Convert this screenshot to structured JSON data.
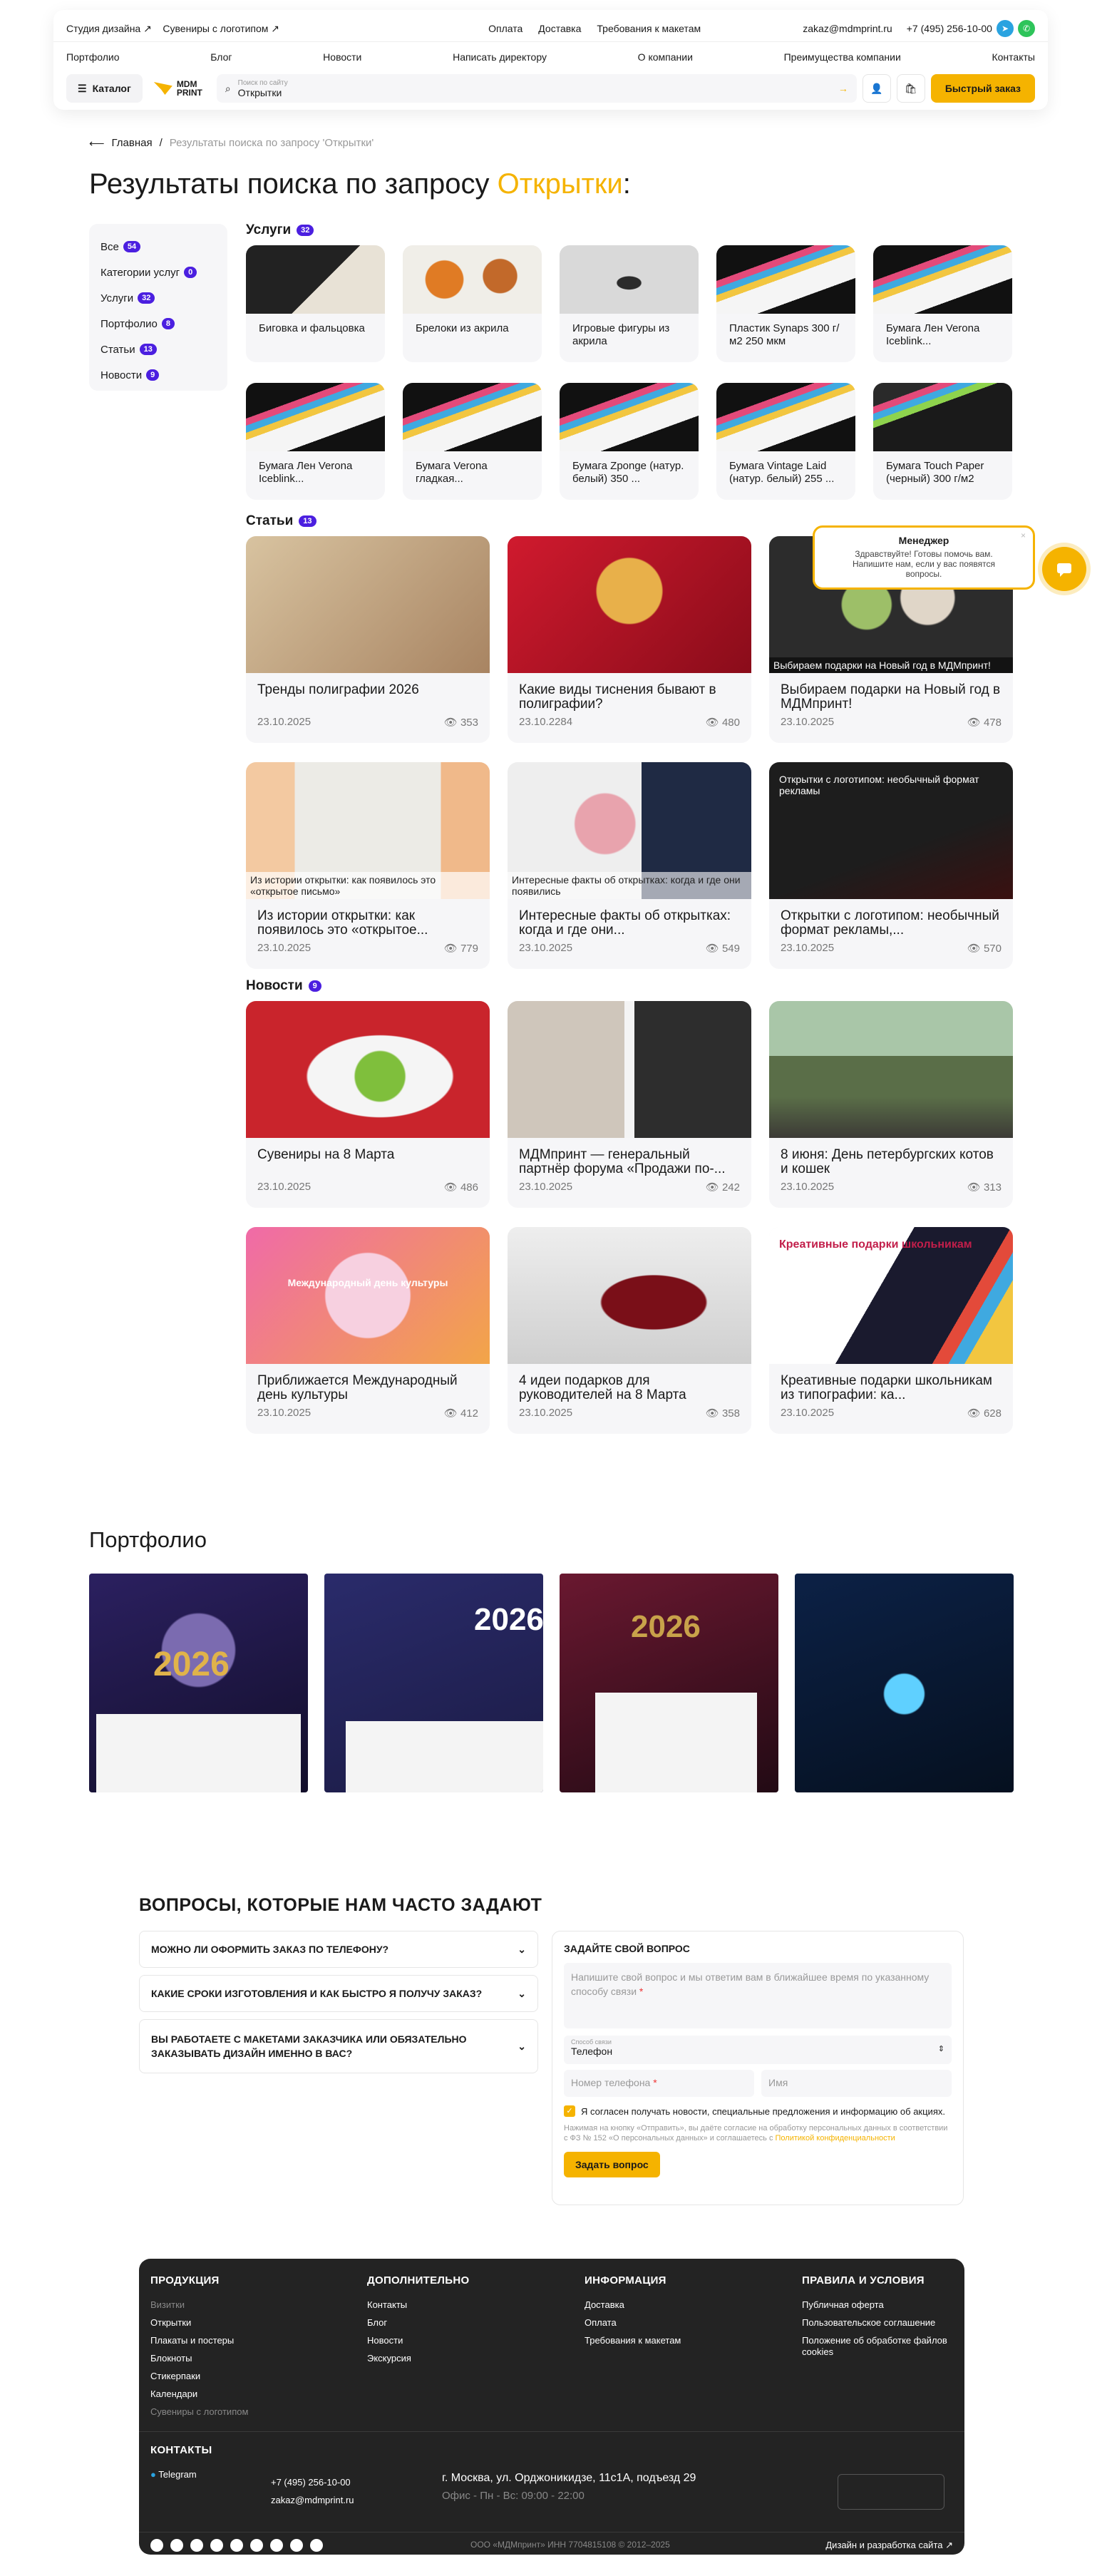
{
  "header": {
    "top_links": [
      "Студия дизайна",
      "Сувениры с логотипом"
    ],
    "mid_links": [
      "Оплата",
      "Доставка",
      "Требования к макетам"
    ],
    "email": "zakaz@mdmprint.ru",
    "phone": "+7 (495) 256-10-00",
    "nav": [
      "Портфолио",
      "Блог",
      "Новости",
      "Написать директору",
      "О компании",
      "Преимущества компании",
      "Контакты"
    ],
    "catalog": "Каталог",
    "logo": "MDM PRINT",
    "search_placeholder": "Поиск по сайту",
    "search_value": "Открытки",
    "quick_order": "Быстрый заказ"
  },
  "breadcrumbs": {
    "home": "Главная",
    "current": "Результаты поиска по запросу 'Открытки'"
  },
  "title": {
    "prefix": "Результаты поиска по запросу ",
    "query": "Открытки",
    "suffix": ":"
  },
  "filters": [
    {
      "label": "Все",
      "count": "54"
    },
    {
      "label": "Категории услуг",
      "count": "0"
    },
    {
      "label": "Услуги",
      "count": "32"
    },
    {
      "label": "Портфолио",
      "count": "8"
    },
    {
      "label": "Статьи",
      "count": "13"
    },
    {
      "label": "Новости",
      "count": "9"
    }
  ],
  "services": {
    "title": "Услуги",
    "count": "32",
    "items": [
      "Биговка и фальцовка",
      "Брелоки из акрила",
      "Игровые фигуры из акрила",
      "Пластик Synaps 300 г/м2 250 мкм",
      "Бумага Лен Verona Iceblink...",
      "Бумага Лен Verona Iceblink...",
      "Бумага Verona гладкая...",
      "Бумага Zponge (натур. белый) 350 ...",
      "Бумага Vintage Laid (натур. белый) 255 ...",
      "Бумага Touch Paper (черный) 300 г/м2"
    ]
  },
  "articles": {
    "title": "Статьи",
    "count": "13",
    "items": [
      {
        "title": "Тренды полиграфии 2026",
        "date": "23.10.2025",
        "views": "353"
      },
      {
        "title": "Какие виды тиснения бывают в полиграфии?",
        "date": "23.10.2284",
        "views": "480"
      },
      {
        "title": "Выбираем подарки на Новый год в МДМпринт!",
        "date": "23.10.2025",
        "views": "478",
        "caption": "Выбираем подарки на Новый год в МДМпринт!"
      },
      {
        "title": "Из истории открытки: как появилось это «открытое...",
        "date": "23.10.2025",
        "views": "779",
        "caption": "Из истории открытки: как появилось это «открытое письмо»"
      },
      {
        "title": "Интересные факты об открытках: когда и где они...",
        "date": "23.10.2025",
        "views": "549",
        "caption": "Интересные факты об открытках: когда и где они появились"
      },
      {
        "title": "Открытки с логотипом: необычный формат рекламы,...",
        "date": "23.10.2025",
        "views": "570",
        "caption": "Открытки с логотипом: необычный формат рекламы"
      }
    ]
  },
  "news": {
    "title": "Новости",
    "count": "9",
    "items": [
      {
        "title": "Сувениры на 8 Марта",
        "date": "23.10.2025",
        "views": "486"
      },
      {
        "title": "МДМпринт — генеральный партнёр форума «Продажи по-...",
        "date": "23.10.2025",
        "views": "242"
      },
      {
        "title": "8 июня: День петербургских котов и кошек",
        "date": "23.10.2025",
        "views": "313"
      },
      {
        "title": "Приближается Международный день культуры",
        "date": "23.10.2025",
        "views": "412",
        "caption": "Международный день культуры"
      },
      {
        "title": "4 идеи подарков для руководителей на 8 Марта",
        "date": "23.10.2025",
        "views": "358"
      },
      {
        "title": "Креативные подарки школьникам из типографии: ка...",
        "date": "23.10.2025",
        "views": "628",
        "caption": "Креативные подарки школьникам"
      }
    ]
  },
  "chat": {
    "title": "Менеджер",
    "text": "Здравствуйте! Готовы помочь вам. Напишите нам, если у вас появятся вопросы."
  },
  "portfolio": {
    "title": "Портфолио",
    "captions": [
      "2026",
      "2026",
      "2026",
      ""
    ]
  },
  "faq": {
    "title": "ВОПРОСЫ, КОТОРЫЕ НАМ ЧАСТО ЗАДАЮТ",
    "items": [
      "МОЖНО ЛИ ОФОРМИТЬ ЗАКАЗ ПО ТЕЛЕФОНУ?",
      "КАКИЕ СРОКИ ИЗГОТОВЛЕНИЯ И КАК БЫСТРО Я ПОЛУЧУ ЗАКАЗ?",
      "ВЫ РАБОТАЕТЕ С МАКЕТАМИ ЗАКАЗЧИКА ИЛИ ОБЯЗАТЕЛЬНО ЗАКАЗЫВАТЬ ДИЗАЙН ИМЕННО В ВАС?"
    ]
  },
  "form": {
    "title": "ЗАДАЙТЕ СВОЙ ВОПРОС",
    "question_ph": "Напишите свой вопрос и мы ответим вам в ближайшее время по указанному способу связи",
    "method_label": "Способ связи",
    "method": "Телефон",
    "phone_ph": "Номер телефона",
    "name_ph": "Имя",
    "consent": "Я согласен получать новости, специальные предложения и информацию об акциях.",
    "legal": "Нажимая на кнопку «Отправить», вы даёте согласие на обработку персональных данных в соответствии с ФЗ № 152 «О персональных данных» и соглашаетесь с ",
    "legal_link": "Политикой конфиденциальности",
    "submit": "Задать вопрос"
  },
  "footer": {
    "cols": [
      {
        "title": "ПРОДУКЦИЯ",
        "items": [
          "Визитки",
          "Открытки",
          "Плакаты и постеры",
          "Блокноты",
          "Стикерпаки",
          "Календари",
          "Сувениры с логотипом"
        ]
      },
      {
        "title": "ДОПОЛНИТЕЛЬНО",
        "items": [
          "Контакты",
          "Блог",
          "Новости",
          "Экскурсия"
        ]
      },
      {
        "title": "ИНФОРМАЦИЯ",
        "items": [
          "Доставка",
          "Оплата",
          "Требования к макетам"
        ]
      },
      {
        "title": "ПРАВИЛА И УСЛОВИЯ",
        "items": [
          "Публичная оферта",
          "Пользовательское соглашение",
          "Положение об обработке файлов cookies"
        ]
      }
    ],
    "contacts_title": "КОНТАКТЫ",
    "telegram": "Telegram",
    "phone": "+7 (495) 256-10-00",
    "email": "zakaz@mdmprint.ru",
    "address": "г. Москва, ул. Орджоникидзе, 11с1А, подъезд 29",
    "hours": "Офис - Пн - Вс: 09:00 - 22:00",
    "legal": "ООО «МДМпринт»   ИНН 7704815108   © 2012–2025",
    "dev": "Дизайн и разработка сайта"
  }
}
